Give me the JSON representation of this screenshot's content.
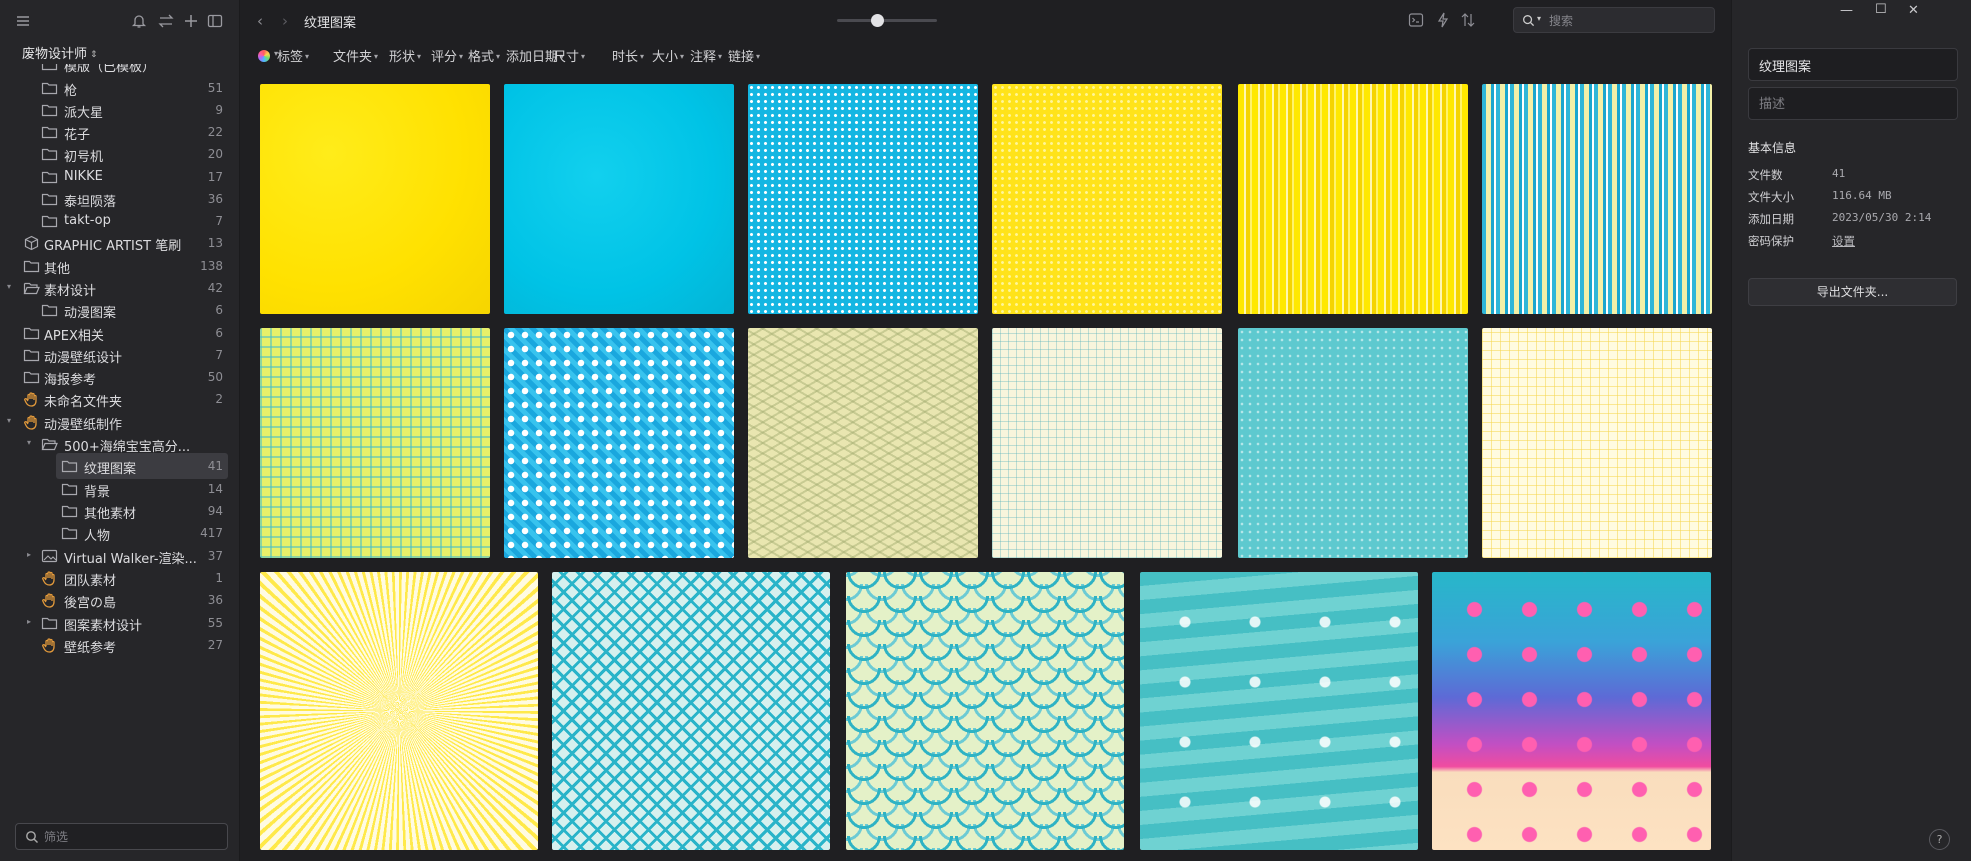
{
  "sidebar": {
    "library_name": "废物设计师",
    "filter_placeholder": "筛选",
    "items": [
      {
        "label": "模版（已模板）",
        "count": ""
      },
      {
        "label": "枪",
        "count": "51"
      },
      {
        "label": "派大星",
        "count": "9"
      },
      {
        "label": "花子",
        "count": "22"
      },
      {
        "label": "初号机",
        "count": "20"
      },
      {
        "label": "NIKKE",
        "count": "17"
      },
      {
        "label": "泰坦陨落",
        "count": "36"
      },
      {
        "label": "takt-op",
        "count": "7"
      },
      {
        "label": "GRAPHIC ARTIST 笔刷",
        "count": "13"
      },
      {
        "label": "其他",
        "count": "138"
      },
      {
        "label": "素材设计",
        "count": "42"
      },
      {
        "label": "动漫图案",
        "count": "6"
      },
      {
        "label": "APEX相关",
        "count": "6"
      },
      {
        "label": "动漫壁纸设计",
        "count": "7"
      },
      {
        "label": "海报参考",
        "count": "50"
      },
      {
        "label": "未命名文件夹",
        "count": "2"
      },
      {
        "label": "动漫壁纸制作",
        "count": ""
      },
      {
        "label": "500+海绵宝宝高分...",
        "count": ""
      },
      {
        "label": "纹理图案",
        "count": "41"
      },
      {
        "label": "背景",
        "count": "14"
      },
      {
        "label": "其他素材",
        "count": "94"
      },
      {
        "label": "人物",
        "count": "417"
      },
      {
        "label": "Virtual Walker-渲染...",
        "count": "37"
      },
      {
        "label": "团队素材",
        "count": "1"
      },
      {
        "label": "後宫の島",
        "count": "36"
      },
      {
        "label": "图案素材设计",
        "count": "55"
      },
      {
        "label": "壁纸参考",
        "count": "27"
      }
    ]
  },
  "toolbar": {
    "title": "纹理图案",
    "zoom": 0.4,
    "search_placeholder": "搜索"
  },
  "filters": [
    "标签",
    "文件夹",
    "形状",
    "评分",
    "格式",
    "添加日期",
    "尺寸",
    "时长",
    "大小",
    "注释",
    "链接"
  ],
  "grid": {
    "tiles": [
      {
        "name": "tile-yellow-paper"
      },
      {
        "name": "tile-cyan-paper"
      },
      {
        "name": "tile-blue-dots"
      },
      {
        "name": "tile-yellow-dots"
      },
      {
        "name": "tile-yellow-stripes"
      },
      {
        "name": "tile-cyan-yellow-stripes"
      },
      {
        "name": "tile-lime-grid"
      },
      {
        "name": "tile-blue-diamond"
      },
      {
        "name": "tile-beige-wave"
      },
      {
        "name": "tile-cream-plaid"
      },
      {
        "name": "tile-teal-dots"
      },
      {
        "name": "tile-cream-yellow-grid"
      },
      {
        "name": "tile-yellow-rays"
      },
      {
        "name": "tile-cyan-chevron"
      },
      {
        "name": "tile-scales"
      },
      {
        "name": "tile-ocean-bubbles"
      },
      {
        "name": "tile-jellyfish-beach"
      }
    ]
  },
  "inspector": {
    "name_value": "纹理图案",
    "desc_placeholder": "描述",
    "section_title": "基本信息",
    "info": [
      {
        "key": "文件数",
        "value": "41"
      },
      {
        "key": "文件大小",
        "value": "116.64 MB"
      },
      {
        "key": "添加日期",
        "value": "2023/05/30 2:14"
      },
      {
        "key": "密码保护",
        "value": "设置"
      }
    ],
    "export_label": "导出文件夹...",
    "help_label": "?"
  },
  "window": {
    "minimize": "—",
    "maximize": "☐",
    "close": "✕"
  }
}
